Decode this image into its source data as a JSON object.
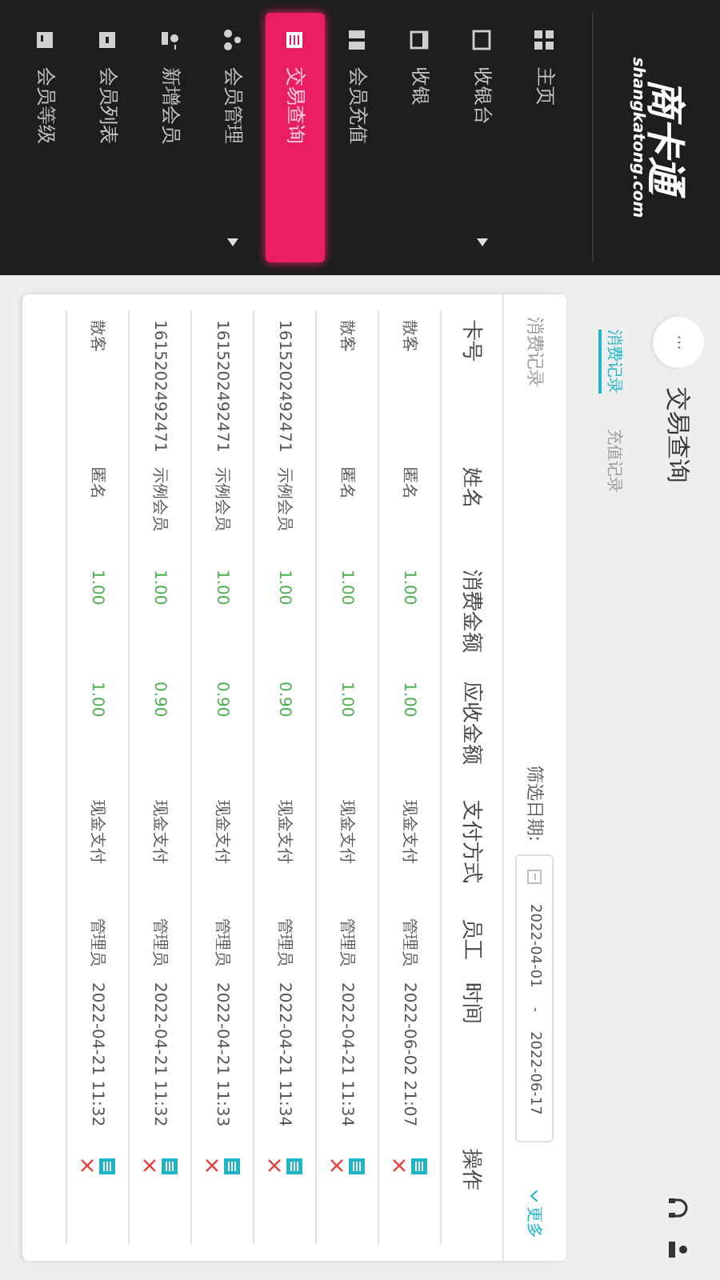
{
  "logo": {
    "name": "商卡通",
    "domain": "shangkatong.com"
  },
  "sidebar": {
    "items": [
      {
        "label": "主页",
        "selected": false,
        "has_submenu": false
      },
      {
        "label": "收银台",
        "selected": false,
        "has_submenu": true
      },
      {
        "label": "收银",
        "selected": false,
        "has_submenu": false
      },
      {
        "label": "会员充值",
        "selected": false,
        "has_submenu": false
      },
      {
        "label": "交易查询",
        "selected": true,
        "has_submenu": false
      },
      {
        "label": "会员管理",
        "selected": false,
        "has_submenu": true
      },
      {
        "label": "新增会员",
        "selected": false,
        "has_submenu": false
      },
      {
        "label": "会员列表",
        "selected": false,
        "has_submenu": false
      },
      {
        "label": "会员等级",
        "selected": false,
        "has_submenu": false
      }
    ]
  },
  "header": {
    "more_button": "···",
    "title": "交易查询"
  },
  "tabs": [
    {
      "label": "消费记录",
      "selected": true
    },
    {
      "label": "充值记录",
      "selected": false
    }
  ],
  "card": {
    "title": "消费记录",
    "filter_label": "筛选日期:",
    "date_from": "2022-04-01",
    "date_sep": "-",
    "date_to": "2022-06-17",
    "more_link": "更多"
  },
  "table": {
    "columns": [
      "卡号",
      "姓名",
      "消费金额",
      "应收金额",
      "支付方式",
      "员工",
      "时间",
      "操作"
    ],
    "rows": [
      {
        "card": "散客",
        "name": "匿名",
        "amount": "1.00",
        "due": "1.00",
        "payment": "现金支付",
        "staff": "管理员",
        "time": "2022-06-02 21:07"
      },
      {
        "card": "散客",
        "name": "匿名",
        "amount": "1.00",
        "due": "1.00",
        "payment": "现金支付",
        "staff": "管理员",
        "time": "2022-04-21 11:34"
      },
      {
        "card": "1615202492471",
        "name": "示例会员",
        "amount": "1.00",
        "due": "0.90",
        "payment": "现金支付",
        "staff": "管理员",
        "time": "2022-04-21 11:34"
      },
      {
        "card": "1615202492471",
        "name": "示例会员",
        "amount": "1.00",
        "due": "0.90",
        "payment": "现金支付",
        "staff": "管理员",
        "time": "2022-04-21 11:33"
      },
      {
        "card": "1615202492471",
        "name": "示例会员",
        "amount": "1.00",
        "due": "0.90",
        "payment": "现金支付",
        "staff": "管理员",
        "time": "2022-04-21 11:32"
      },
      {
        "card": "散客",
        "name": "匿名",
        "amount": "1.00",
        "due": "1.00",
        "payment": "现金支付",
        "staff": "管理员",
        "time": "2022-04-21 11:32"
      }
    ]
  }
}
